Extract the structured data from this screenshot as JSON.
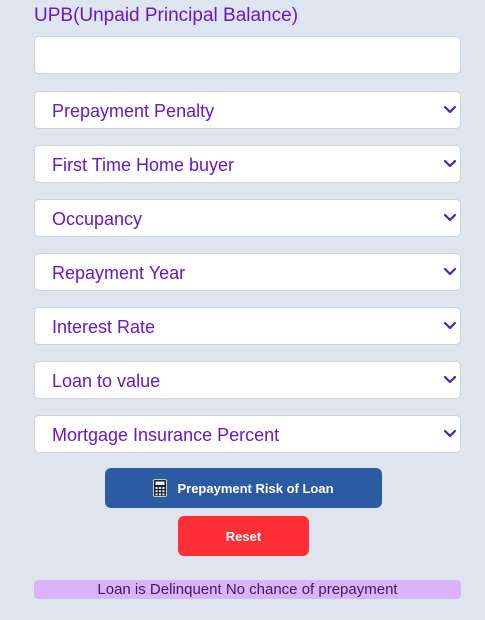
{
  "upb": {
    "label": "UPB(Unpaid Principal Balance)",
    "value": ""
  },
  "selects": [
    {
      "label": "Prepayment Penalty"
    },
    {
      "label": "First Time Home buyer"
    },
    {
      "label": "Occupancy"
    },
    {
      "label": "Repayment Year"
    },
    {
      "label": "Interest Rate"
    },
    {
      "label": "Loan to value"
    },
    {
      "label": "Mortgage Insurance Percent"
    }
  ],
  "buttons": {
    "predict_label": "Prepayment Risk of Loan",
    "predict_icon": "calculator-icon",
    "reset_label": "Reset"
  },
  "result": {
    "message": "Loan is Delinquent No chance of prepayment"
  },
  "colors": {
    "background": "#dfe5ee",
    "label_text": "#6a17c4",
    "primary_button": "#2c5aa3",
    "reset_button": "#ff2f35",
    "result_bar": "#dcb2fb"
  }
}
